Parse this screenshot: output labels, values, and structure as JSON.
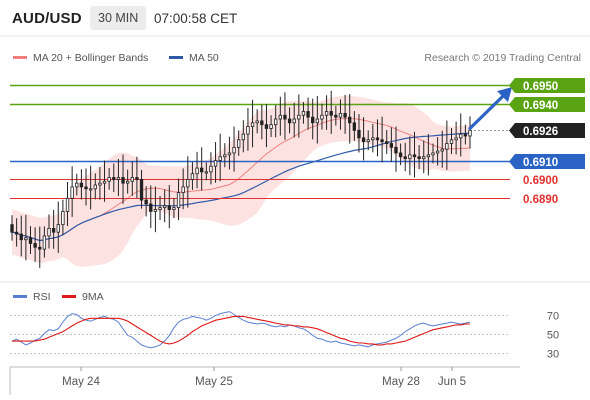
{
  "header": {
    "pair": "AUD/USD",
    "timeframe": "30 MIN",
    "time": "07:00:58 CET"
  },
  "legend": {
    "items": [
      {
        "label": "MA 20 + Bollinger Bands",
        "color": "#f08080"
      },
      {
        "label": "MA 50",
        "color": "#2f5aa8"
      }
    ],
    "credit": "Research © 2019 Trading Central"
  },
  "colors": {
    "resistance": "#5aa312",
    "pivot": "#2b63c4",
    "support": "#e03030",
    "price": "#222222",
    "up_candle": "#222222",
    "bb_fill": "#fde2e2",
    "rsi": "#5a7fd1",
    "rsi_ma": "#e01818",
    "arrow": "#2b63c4"
  },
  "chart_data": [
    {
      "type": "candlestick",
      "title": "",
      "x_tick_labels": [
        "May 24",
        "May 25",
        "May 28",
        "Jun 5"
      ],
      "x_tick_positions": [
        15,
        44,
        85,
        96
      ],
      "ylim": [
        0.6853,
        0.6958
      ],
      "levels": [
        {
          "value": 0.695,
          "label": "0.6950",
          "kind": "resistance"
        },
        {
          "value": 0.694,
          "label": "0.6940",
          "kind": "resistance"
        },
        {
          "value": 0.6926,
          "label": "0.6926",
          "kind": "last_price"
        },
        {
          "value": 0.691,
          "label": "0.6910",
          "kind": "pivot"
        },
        {
          "value": 0.69,
          "label": "0.6900",
          "kind": "support"
        },
        {
          "value": 0.689,
          "label": "0.6890",
          "kind": "support"
        }
      ],
      "projection": {
        "from_value": 0.6926,
        "to_value": 0.695
      },
      "close": [
        0.6872,
        0.6871,
        0.6868,
        0.6869,
        0.6866,
        0.6864,
        0.6863,
        0.687,
        0.6874,
        0.6872,
        0.6876,
        0.6883,
        0.689,
        0.6896,
        0.6898,
        0.6896,
        0.6895,
        0.6895,
        0.6897,
        0.6898,
        0.6899,
        0.6901,
        0.69,
        0.6901,
        0.6898,
        0.6899,
        0.6901,
        0.69,
        0.6889,
        0.6887,
        0.6883,
        0.6884,
        0.6885,
        0.6886,
        0.6884,
        0.6885,
        0.6893,
        0.6896,
        0.69,
        0.6903,
        0.6906,
        0.6904,
        0.6904,
        0.6907,
        0.691,
        0.6912,
        0.6913,
        0.6914,
        0.6917,
        0.6921,
        0.6924,
        0.6928,
        0.693,
        0.6931,
        0.6929,
        0.6927,
        0.6929,
        0.6932,
        0.6934,
        0.6932,
        0.693,
        0.6932,
        0.6934,
        0.6936,
        0.6933,
        0.693,
        0.6932,
        0.6934,
        0.6936,
        0.6934,
        0.6933,
        0.6935,
        0.6933,
        0.693,
        0.6926,
        0.6922,
        0.692,
        0.6921,
        0.6922,
        0.6921,
        0.692,
        0.6919,
        0.6917,
        0.6914,
        0.6912,
        0.6911,
        0.6913,
        0.6912,
        0.6911,
        0.6912,
        0.6913,
        0.6914,
        0.6915,
        0.6916,
        0.6919,
        0.6921,
        0.6922,
        0.6924,
        0.6923,
        0.6926
      ]
    },
    {
      "type": "line",
      "title": "",
      "series": [
        {
          "name": "RSI",
          "values": [
            42,
            44,
            41,
            38,
            40,
            43,
            45,
            50,
            54,
            53,
            55,
            62,
            68,
            71,
            70,
            66,
            64,
            63,
            65,
            67,
            68,
            66,
            65,
            62,
            55,
            48,
            46,
            42,
            38,
            36,
            35,
            36,
            38,
            42,
            48,
            56,
            62,
            65,
            66,
            68,
            67,
            66,
            64,
            66,
            69,
            71,
            72,
            73,
            70,
            67,
            64,
            62,
            61,
            60,
            61,
            60,
            58,
            57,
            58,
            57,
            59,
            58,
            56,
            55,
            52,
            48,
            45,
            44,
            42,
            41,
            42,
            40,
            39,
            38,
            37,
            38,
            37,
            36,
            38,
            39,
            40,
            41,
            43,
            45,
            48,
            52,
            55,
            58,
            60,
            61,
            59,
            58,
            59,
            60,
            61,
            62,
            61,
            60,
            61,
            62
          ]
        },
        {
          "name": "9MA",
          "values": [
            42,
            42,
            42,
            42,
            42,
            42,
            43,
            44,
            46,
            48,
            50,
            52,
            55,
            58,
            61,
            63,
            65,
            66,
            66,
            66,
            66,
            66,
            66,
            66,
            65,
            63,
            60,
            57,
            54,
            51,
            48,
            45,
            42,
            40,
            39,
            40,
            42,
            45,
            48,
            52,
            55,
            58,
            60,
            62,
            64,
            65,
            66,
            67,
            68,
            68,
            68,
            67,
            66,
            65,
            64,
            63,
            62,
            61,
            60,
            59,
            59,
            58,
            58,
            57,
            57,
            56,
            55,
            53,
            51,
            49,
            47,
            45,
            44,
            42,
            41,
            40,
            40,
            39,
            39,
            38,
            38,
            39,
            39,
            40,
            41,
            42,
            44,
            46,
            48,
            50,
            52,
            54,
            55,
            56,
            57,
            58,
            59,
            59,
            60,
            60
          ]
        }
      ],
      "ylim": [
        20,
        80
      ],
      "y_ticks": [
        "70",
        "50",
        "30"
      ],
      "grid": true
    }
  ]
}
